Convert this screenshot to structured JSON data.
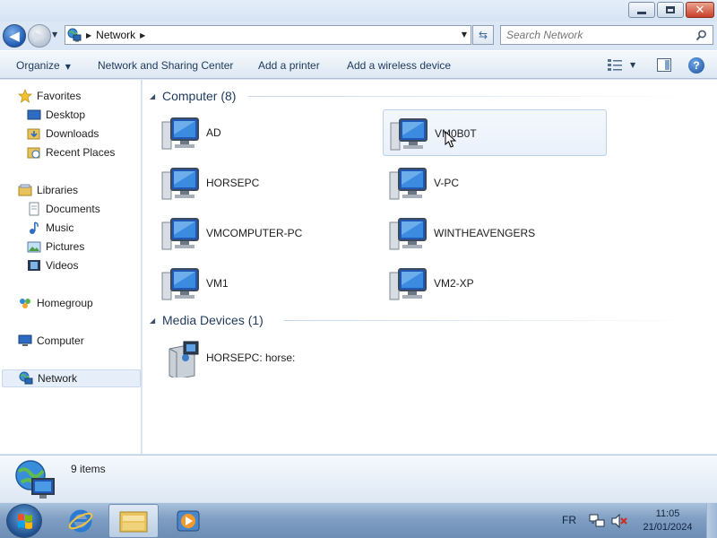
{
  "window": {
    "controls": {
      "minimize": "minimize",
      "maximize": "maximize",
      "close": "close"
    }
  },
  "address": {
    "location": "Network",
    "search_placeholder": "Search Network"
  },
  "toolbar": {
    "organize": "Organize",
    "network_sharing_center": "Network and Sharing Center",
    "add_printer": "Add a printer",
    "add_wireless": "Add a wireless device"
  },
  "nav": {
    "favorites": "Favorites",
    "desktop": "Desktop",
    "downloads": "Downloads",
    "recent_places": "Recent Places",
    "libraries": "Libraries",
    "documents": "Documents",
    "music": "Music",
    "pictures": "Pictures",
    "videos": "Videos",
    "homegroup": "Homegroup",
    "computer": "Computer",
    "network": "Network"
  },
  "content": {
    "computer_group": "Computer (8)",
    "computers": [
      "AD",
      "VM0B0T",
      "HORSEPC",
      "V-PC",
      "VMCOMPUTER-PC",
      "WINTHEAVENGERS",
      "VM1",
      "VM2-XP"
    ],
    "media_group": "Media Devices (1)",
    "media": [
      "HORSEPC: horse:"
    ],
    "selected_item": "VM0B0T"
  },
  "details": {
    "count": "9 items"
  },
  "taskbar": {
    "language": "FR",
    "time": "11:05",
    "date": "21/01/2024"
  },
  "colors": {
    "accent": "#1e395b",
    "selection": "#eaf1fb"
  }
}
